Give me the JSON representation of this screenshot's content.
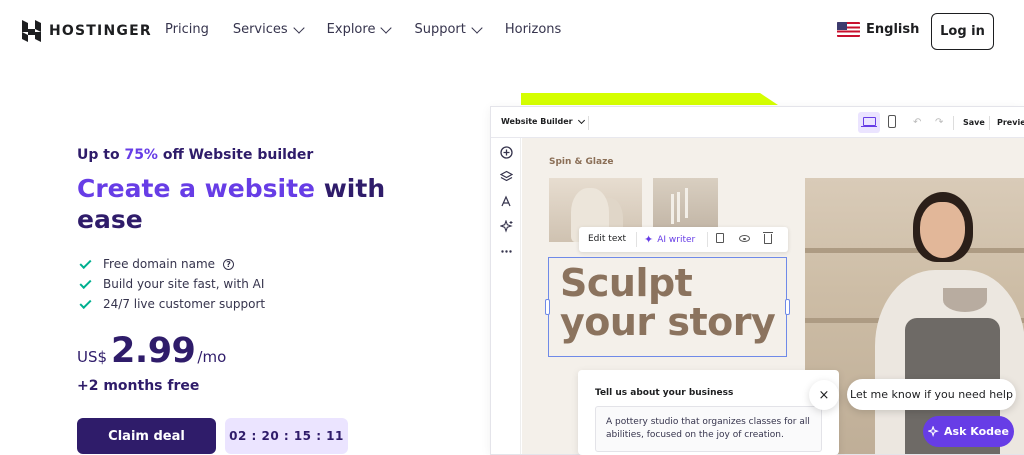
{
  "header": {
    "logo_text": "HOSTINGER",
    "nav": [
      {
        "label": "Pricing",
        "has_dropdown": false
      },
      {
        "label": "Services",
        "has_dropdown": true
      },
      {
        "label": "Explore",
        "has_dropdown": true
      },
      {
        "label": "Support",
        "has_dropdown": true
      },
      {
        "label": "Horizons",
        "has_dropdown": false
      }
    ],
    "language": "English",
    "login_label": "Log in"
  },
  "hero": {
    "promo_prefix": "Up to ",
    "promo_accent": "75%",
    "promo_suffix": " off Website builder",
    "headline_accent": "Create a website",
    "headline_rest": " with ease",
    "features": [
      {
        "label": "Free domain name",
        "has_help": true
      },
      {
        "label": "Build your site fast, with AI",
        "has_help": false
      },
      {
        "label": "24/7 live customer support",
        "has_help": false
      }
    ],
    "currency": "US$",
    "price": "2.99",
    "period": "/mo",
    "bonus": "+2 months free",
    "cta_label": "Claim deal",
    "timer": "02 : 20 : 15 : 11"
  },
  "builder": {
    "title": "Website Builder",
    "save_label": "Save",
    "preview_label": "Preview",
    "brand": "Spin & Glaze",
    "edit_text_label": "Edit text",
    "ai_writer_label": "AI writer",
    "headline_line1": "Sculpt",
    "headline_line2": "your story",
    "prompt_title": "Tell us about your business",
    "prompt_text": "A pottery studio that organizes classes for all abilities, focused on the joy of creation."
  },
  "chat": {
    "bubble_text": "Let me know if you need help",
    "close_symbol": "×",
    "kodee_label": "Ask Kodee"
  },
  "colors": {
    "brand_dark": "#2f1c6a",
    "brand_accent": "#673de6",
    "check_green": "#00b090",
    "lime": "#d5ff00"
  }
}
